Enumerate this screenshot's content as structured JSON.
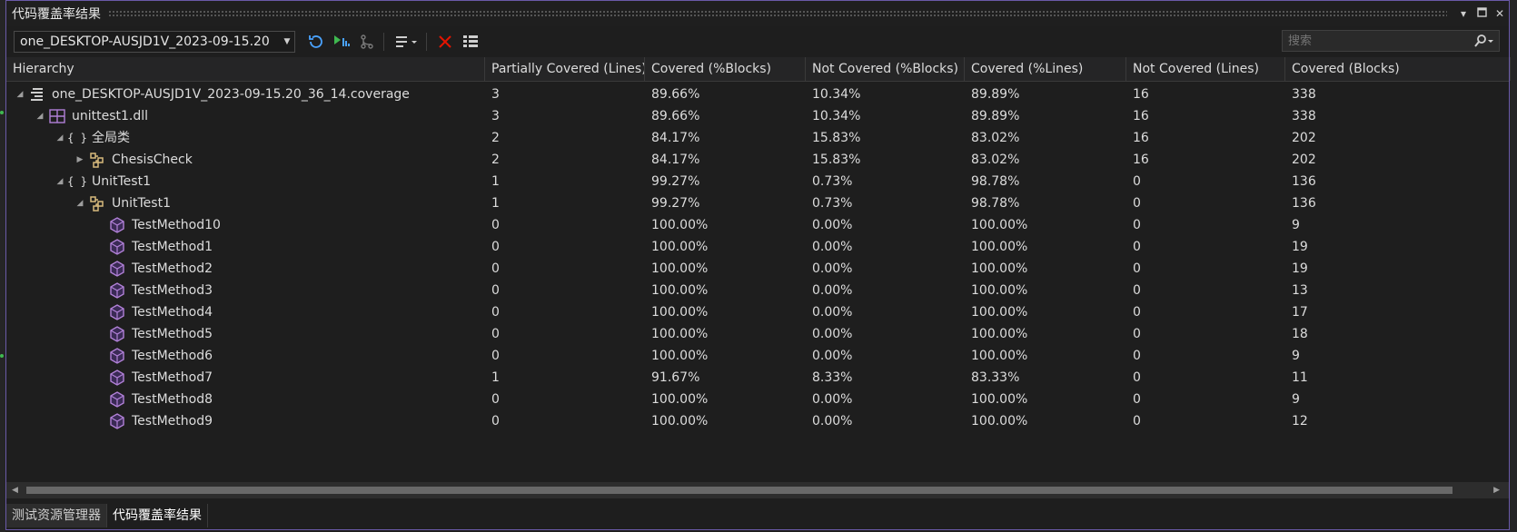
{
  "window": {
    "title": "代码覆盖率结果"
  },
  "toolbar": {
    "coverage_file": "one_DESKTOP-AUSJD1V_2023-09-15.20",
    "search_placeholder": "搜索"
  },
  "columns": [
    "Hierarchy",
    "Partially Covered (Lines)",
    "Covered (%Blocks)",
    "Not Covered (%Blocks)",
    "Covered (%Lines)",
    "Not Covered (Lines)",
    "Covered (Blocks)"
  ],
  "rows": [
    {
      "name": "one_DESKTOP-AUSJD1V_2023-09-15.20_36_14.coverage",
      "icon": "coverage-file-icon",
      "level": 0,
      "expander": "expanded",
      "values": [
        "3",
        "89.66%",
        "10.34%",
        "89.89%",
        "16",
        "338"
      ]
    },
    {
      "name": "unittest1.dll",
      "icon": "module-icon",
      "level": 1,
      "expander": "expanded",
      "values": [
        "3",
        "89.66%",
        "10.34%",
        "89.89%",
        "16",
        "338"
      ]
    },
    {
      "name": "全局类",
      "icon": "namespace-icon",
      "level": 2,
      "expander": "expanded",
      "values": [
        "2",
        "84.17%",
        "15.83%",
        "83.02%",
        "16",
        "202"
      ]
    },
    {
      "name": "ChesisCheck",
      "icon": "class-icon",
      "level": 3,
      "expander": "collapsed",
      "values": [
        "2",
        "84.17%",
        "15.83%",
        "83.02%",
        "16",
        "202"
      ]
    },
    {
      "name": "UnitTest1",
      "icon": "namespace-icon",
      "level": 2,
      "expander": "expanded",
      "values": [
        "1",
        "99.27%",
        "0.73%",
        "98.78%",
        "0",
        "136"
      ]
    },
    {
      "name": "UnitTest1",
      "icon": "class-icon",
      "level": 3,
      "expander": "expanded",
      "values": [
        "1",
        "99.27%",
        "0.73%",
        "98.78%",
        "0",
        "136"
      ]
    },
    {
      "name": "TestMethod10",
      "icon": "method-icon",
      "level": 4,
      "expander": "none",
      "values": [
        "0",
        "100.00%",
        "0.00%",
        "100.00%",
        "0",
        "9"
      ]
    },
    {
      "name": "TestMethod1",
      "icon": "method-icon",
      "level": 4,
      "expander": "none",
      "values": [
        "0",
        "100.00%",
        "0.00%",
        "100.00%",
        "0",
        "19"
      ]
    },
    {
      "name": "TestMethod2",
      "icon": "method-icon",
      "level": 4,
      "expander": "none",
      "values": [
        "0",
        "100.00%",
        "0.00%",
        "100.00%",
        "0",
        "19"
      ]
    },
    {
      "name": "TestMethod3",
      "icon": "method-icon",
      "level": 4,
      "expander": "none",
      "values": [
        "0",
        "100.00%",
        "0.00%",
        "100.00%",
        "0",
        "13"
      ]
    },
    {
      "name": "TestMethod4",
      "icon": "method-icon",
      "level": 4,
      "expander": "none",
      "values": [
        "0",
        "100.00%",
        "0.00%",
        "100.00%",
        "0",
        "17"
      ]
    },
    {
      "name": "TestMethod5",
      "icon": "method-icon",
      "level": 4,
      "expander": "none",
      "values": [
        "0",
        "100.00%",
        "0.00%",
        "100.00%",
        "0",
        "18"
      ]
    },
    {
      "name": "TestMethod6",
      "icon": "method-icon",
      "level": 4,
      "expander": "none",
      "values": [
        "0",
        "100.00%",
        "0.00%",
        "100.00%",
        "0",
        "9"
      ]
    },
    {
      "name": "TestMethod7",
      "icon": "method-icon",
      "level": 4,
      "expander": "none",
      "values": [
        "1",
        "91.67%",
        "8.33%",
        "83.33%",
        "0",
        "11"
      ]
    },
    {
      "name": "TestMethod8",
      "icon": "method-icon",
      "level": 4,
      "expander": "none",
      "values": [
        "0",
        "100.00%",
        "0.00%",
        "100.00%",
        "0",
        "9"
      ]
    },
    {
      "name": "TestMethod9",
      "icon": "method-icon",
      "level": 4,
      "expander": "none",
      "values": [
        "0",
        "100.00%",
        "0.00%",
        "100.00%",
        "0",
        "12"
      ]
    }
  ],
  "tabs": [
    {
      "label": "测试资源管理器",
      "active": false
    },
    {
      "label": "代码覆盖率结果",
      "active": true
    }
  ],
  "colors": {
    "accent_border": "#6a5aa8",
    "icon_purple": "#b180d7",
    "icon_gold": "#d7ba7d",
    "run_green": "#3fb950",
    "close_red": "#e51400"
  }
}
